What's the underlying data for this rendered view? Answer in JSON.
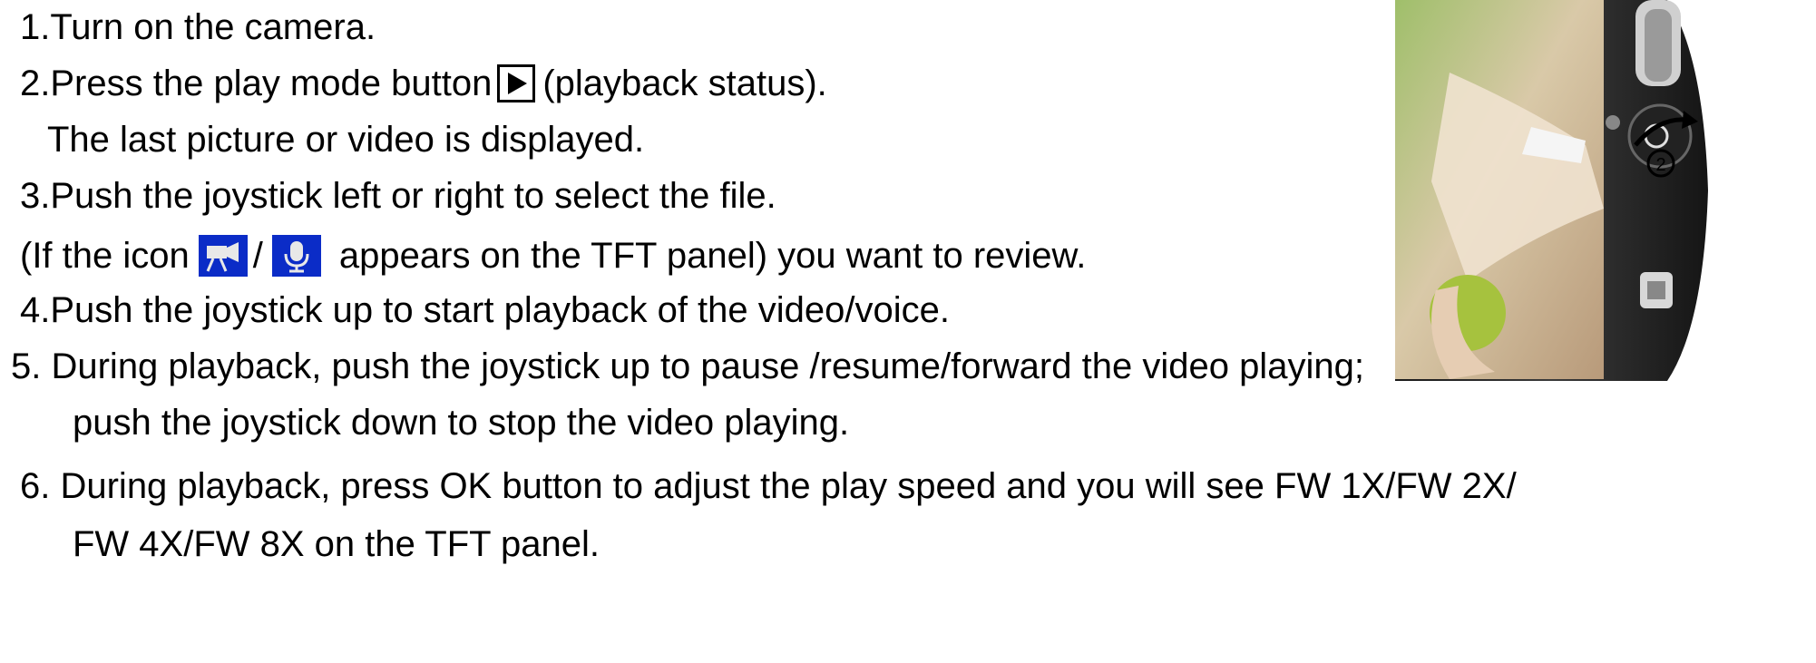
{
  "instructions": {
    "step1": "1.Turn on the camera.",
    "step2_a": "2.Press the play mode button",
    "step2_b": "(playback status).",
    "step2_note": "The last picture or video is displayed.",
    "step3": "3.Push the joystick left or right to select the file.",
    "step3_a": "(If the icon",
    "step3_sep": "/",
    "step3_b": "appears on the TFT panel) you want to review.",
    "step4": "4.Push the joystick up to start playback of the video/voice.",
    "step5": "5. During playback, push the joystick up to pause /resume/forward the video playing;",
    "step5_cont": "push the joystick down to stop the video playing.",
    "step6": "6. During playback, press OK button to adjust the play speed and you will see FW 1X/FW 2X/",
    "step6_cont": "FW 4X/FW 8X on the TFT panel."
  },
  "icons": {
    "play": "play-icon",
    "video": "video-camera-icon",
    "voice": "microphone-icon"
  },
  "photo": {
    "callout": "2"
  }
}
